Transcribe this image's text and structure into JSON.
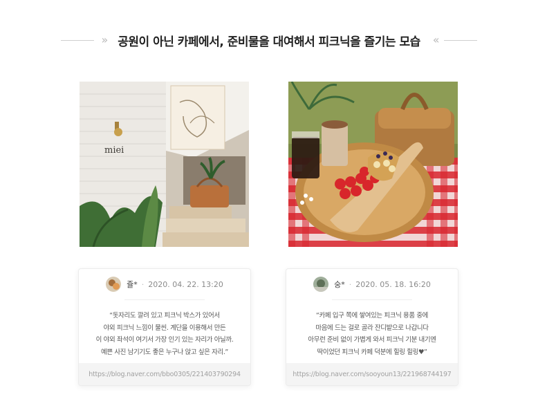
{
  "header": {
    "title": "공원이 아닌 카페에서, 준비물을 대여해서 피크닉을 즐기는 모습",
    "left_arrow": "»",
    "right_arrow": "«"
  },
  "photos": [
    {
      "icon": "cafe-entrance-photo",
      "sign_text": "miei"
    },
    {
      "icon": "picnic-basket-photo"
    }
  ],
  "reviews": [
    {
      "author": "쥴*",
      "separator": "·",
      "date": "2020. 04. 22. 13:20",
      "quote_lines": [
        "“돗자리도 깔려 있고 피크닉 박스가 있어서",
        "야외 피크닉 느낌이 물씬. 계단을 이용해서 만든",
        "이 야외 좌석이 여기서 가장 인기 있는 자리가 아닐까.",
        "예쁜 사진 남기기도 좋은 누구나 앉고 싶은 자리.”"
      ],
      "link": "https://blog.naver.com/bbo0305/221403790294"
    },
    {
      "author": "숭*",
      "separator": "·",
      "date": "2020. 05. 18. 16:20",
      "quote_lines": [
        "“카페 입구 쪽에 쌓여있는 피크닉 용품 중에",
        "마음에 드는 걸로 골라 잔디밭으로 나갑니다",
        "아무런 준비 없이 가볍게 와서 피크닉 기분 내기엔",
        "딱이었던 피크닉 카페 덕분에 힐링 힐링♥”"
      ],
      "link": "https://blog.naver.com/sooyoun13/221968744197"
    }
  ],
  "colors": {
    "title": "#222222",
    "muted": "#8a8a8a",
    "foot_bg": "#f4f4f4",
    "checker_red": "#d9262f"
  }
}
